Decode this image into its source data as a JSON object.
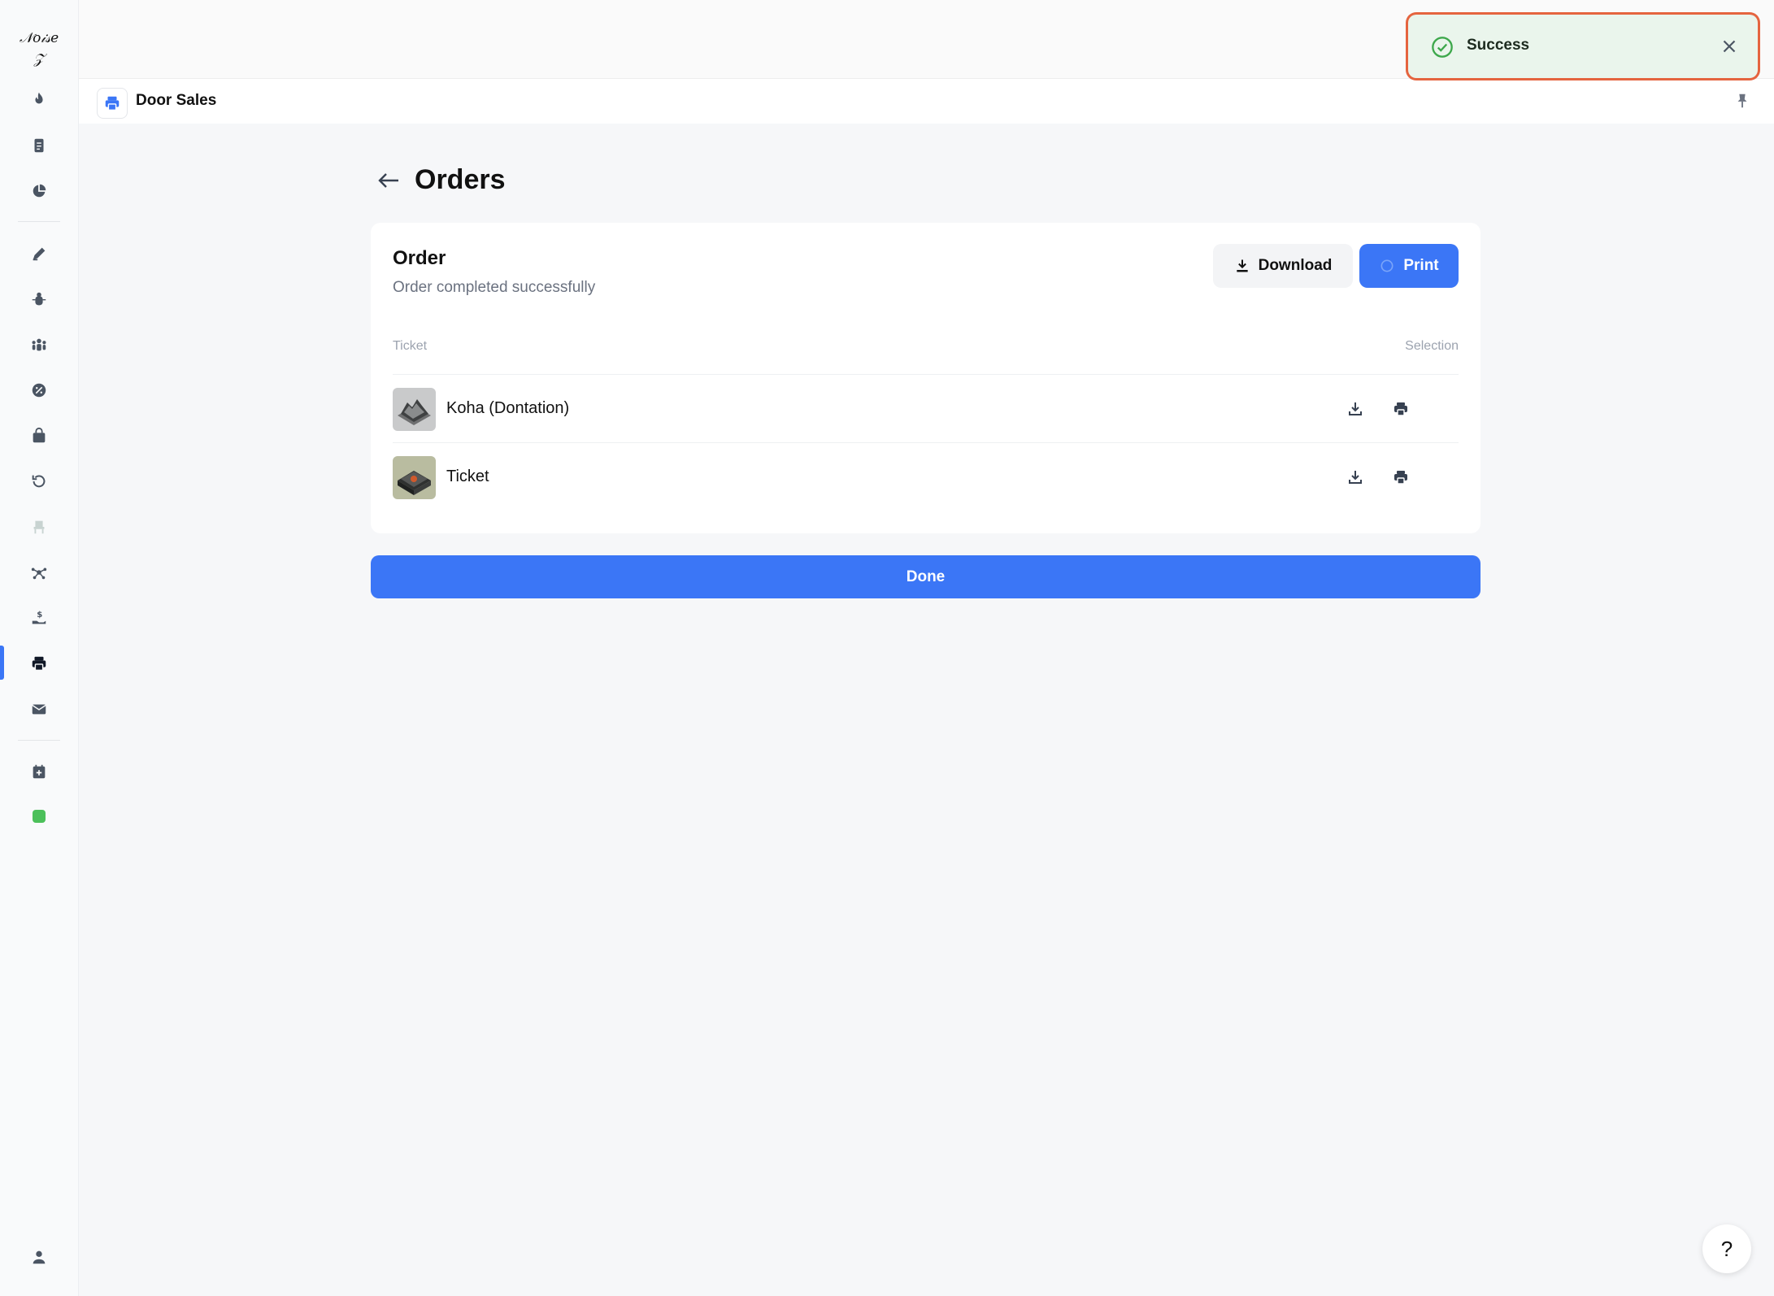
{
  "sidebar": {
    "logo_text": "Noise Z",
    "icons": [
      "flame-icon",
      "document-icon",
      "pie-chart-icon",
      "edit-icon",
      "bug-icon",
      "team-icon",
      "discount-icon",
      "bag-icon",
      "refresh-icon",
      "chair-icon",
      "network-icon",
      "donation-icon",
      "printer-icon",
      "mail-icon",
      "calendar-add-icon",
      "status-icon",
      "user-icon"
    ],
    "active_item": "printer-icon"
  },
  "subheader": {
    "title": "Door Sales"
  },
  "toast": {
    "text": "Success",
    "color": "#eaf5ec",
    "highlight_color": "#e5643f"
  },
  "page": {
    "title": "Orders"
  },
  "order": {
    "title": "Order",
    "subtitle": "Order completed successfully",
    "download_label": "Download",
    "print_label": "Print",
    "columns": {
      "ticket": "Ticket",
      "selection": "Selection"
    },
    "rows": [
      {
        "name": "Koha (Dontation)"
      },
      {
        "name": "Ticket"
      }
    ]
  },
  "done_label": "Done",
  "help_label": "?",
  "colors": {
    "accent": "#3b76f6",
    "status_green": "#4cc05a"
  }
}
